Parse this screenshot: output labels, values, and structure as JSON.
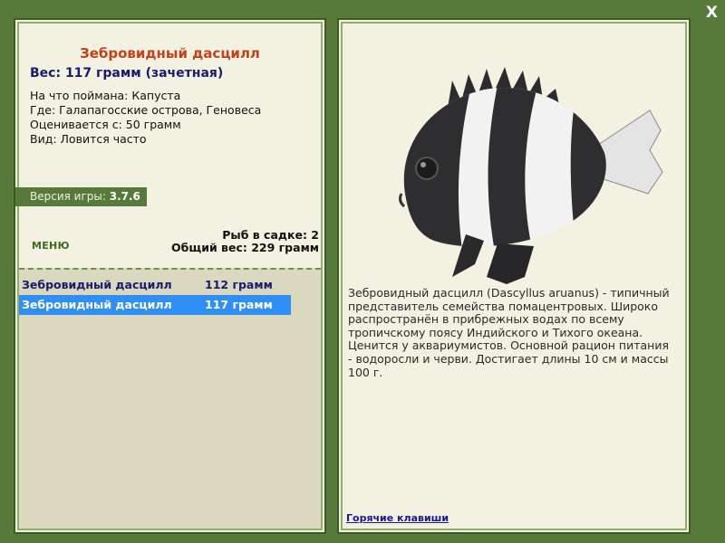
{
  "window": {
    "close_label": "X"
  },
  "fish": {
    "title": "Зебровидный дасцилл",
    "weight_line": "Вес: 117 грамм (зачетная)",
    "details": [
      "На что поймана: Капуста",
      "Где: Галапагосские острова, Геновеса",
      "Оценивается с: 50 грамм",
      "Вид: Ловится часто"
    ]
  },
  "version": {
    "label": "Версия игры:",
    "number": "3.7.6"
  },
  "menu": {
    "label": "МЕНЮ"
  },
  "stats": {
    "fish_in_cage": "Рыб в садке: 2",
    "total_weight": "Общий вес: 229 грамм"
  },
  "catch_list": [
    {
      "name": "Зебровидный дасцилл",
      "weight": "112 грамм",
      "selected": false
    },
    {
      "name": "Зебровидный дасцилл",
      "weight": "117 грамм",
      "selected": true
    }
  ],
  "description": "Зебровидный дасцилл (Dascyllus aruanus) - типичный представитель семейства помацентровых. Широко распространён в прибрежных водах по всему тропичскому поясу Индийского и Тихого океана. Ценится у аквариумистов. Основной рацион питания - водоросли и черви. Достигает длины 10 см и массы 100 г.",
  "hotkeys": {
    "label": "Горячие клавиши"
  },
  "colors": {
    "frame_green": "#577a3a",
    "panel_bg": "#f3f1e2",
    "title_orange": "#c0431a",
    "text_navy": "#1a1a6e",
    "selection_blue": "#2f8ff5"
  }
}
